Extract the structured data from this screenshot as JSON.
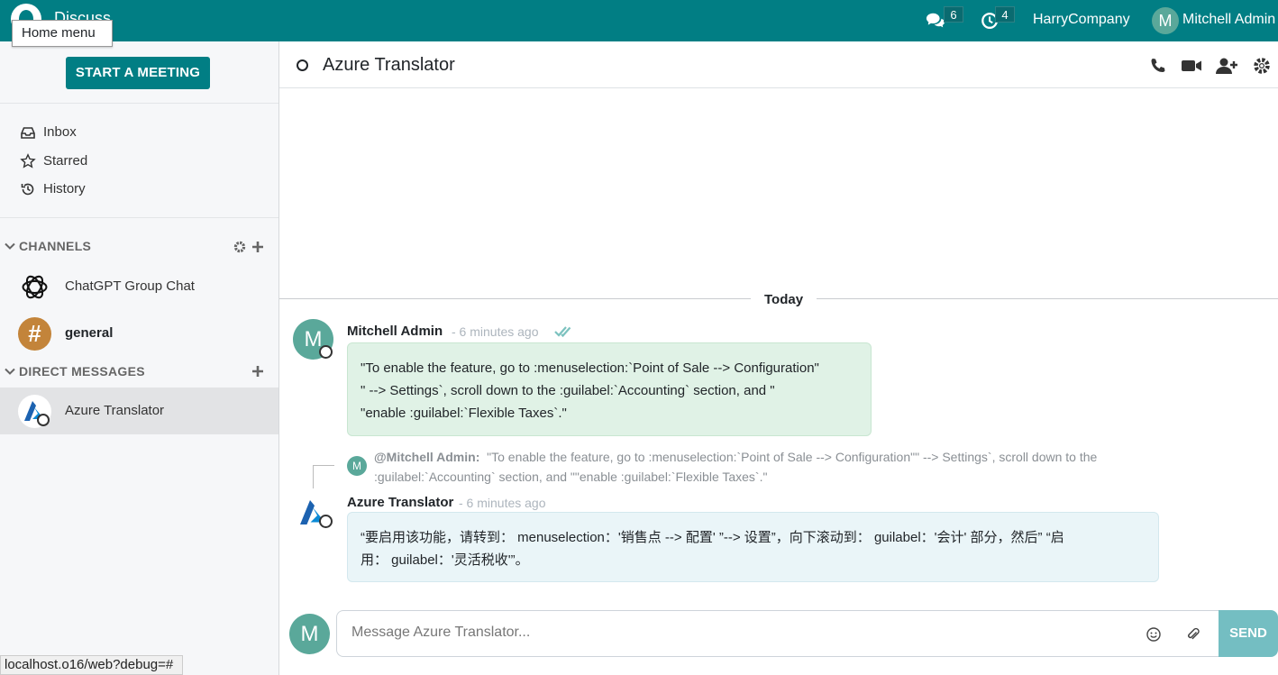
{
  "navbar": {
    "app_name": "Discuss",
    "home_tooltip": "Home menu",
    "messages_badge": "6",
    "activities_badge": "4",
    "company": "HarryCompany",
    "user_initial": "M",
    "user_name": "Mitchell Admin"
  },
  "sidebar": {
    "start_meeting": "START A MEETING",
    "mailboxes": [
      {
        "label": "Inbox",
        "icon": "inbox-icon"
      },
      {
        "label": "Starred",
        "icon": "star-icon"
      },
      {
        "label": "History",
        "icon": "history-icon"
      }
    ],
    "channels_header": "CHANNELS",
    "channels": [
      {
        "name": "ChatGPT Group Chat",
        "icon": "chatgpt-logo-icon"
      },
      {
        "name": "general",
        "avatar_text": "#"
      }
    ],
    "dm_header": "DIRECT MESSAGES",
    "direct_messages": [
      {
        "name": "Azure Translator",
        "icon": "azure-logo-icon",
        "active": true
      }
    ]
  },
  "thread": {
    "title": "Azure Translator",
    "date_separator": "Today",
    "messages": [
      {
        "author": "Mitchell Admin",
        "avatar_initial": "M",
        "time": "- 6 minutes ago",
        "lines": [
          "\"To enable the feature, go to :menuselection:`Point of Sale --> Configuration\"",
          "\" --> Settings`, scroll down to the :guilabel:`Accounting` section, and \"",
          "\"enable :guilabel:`Flexible Taxes`.\""
        ]
      },
      {
        "author": "Azure Translator",
        "time": "- 6 minutes ago",
        "reply_author": "@Mitchell Admin:",
        "reply_initial": "M",
        "reply_text": "\"To enable the feature, go to :menuselection:`Point of Sale --> Configuration\"\" --> Settings`, scroll down to the :guilabel:`Accounting` section, and \"\"enable :guilabel:`Flexible Taxes`.\"",
        "lines": [
          "“要启用该功能，请转到： menuselection：'销售点 --> 配置' ”--> 设置”，向下滚动到： guilabel：'会计' 部分，然后” “启",
          "用： guilabel：'灵活税收'”。"
        ]
      }
    ]
  },
  "composer": {
    "placeholder": "Message Azure Translator...",
    "send": "SEND",
    "avatar_initial": "M"
  },
  "status_bar": {
    "url": "localhost.o16/web?debug=#"
  },
  "colors": {
    "brand": "#017e84",
    "send_disabled": "#74bec2",
    "avatar": "#5aa89a"
  }
}
